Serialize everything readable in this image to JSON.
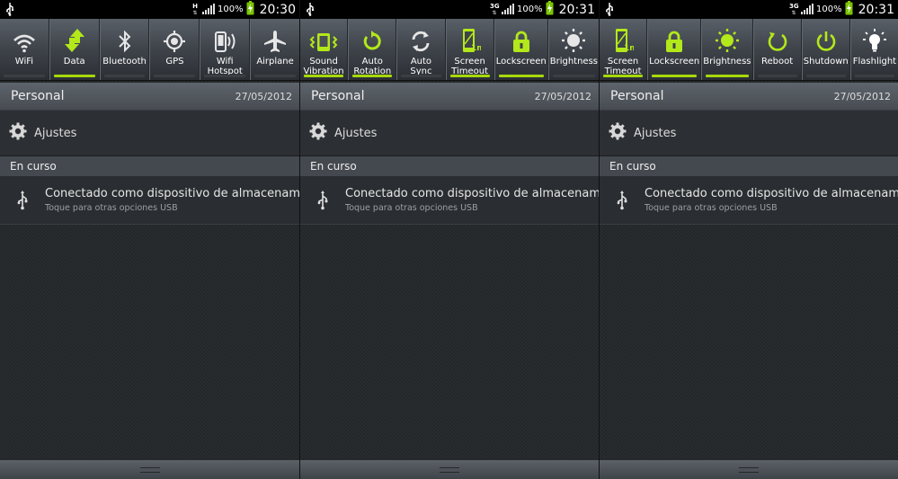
{
  "accent_color": "#a6d80b",
  "panels": [
    {
      "status": {
        "network": "H",
        "battery": "100%",
        "time": "20:30"
      },
      "tiles": [
        {
          "label": "WiFi",
          "icon": "wifi-icon",
          "on": false
        },
        {
          "label": "Data",
          "icon": "data-arrows-icon",
          "on": true
        },
        {
          "label": "Bluetooth",
          "icon": "bluetooth-icon",
          "on": false
        },
        {
          "label": "GPS",
          "icon": "gps-icon",
          "on": false
        },
        {
          "label": "Wifi\nHotspot",
          "icon": "hotspot-icon",
          "on": false
        },
        {
          "label": "Airplane",
          "icon": "airplane-icon",
          "on": false
        }
      ]
    },
    {
      "status": {
        "network": "3G",
        "battery": "100%",
        "time": "20:31"
      },
      "tiles": [
        {
          "label": "Sound\nVibration",
          "icon": "vibration-icon",
          "on": true
        },
        {
          "label": "Auto\nRotation",
          "icon": "rotation-icon",
          "on": true
        },
        {
          "label": "Auto Sync",
          "icon": "sync-icon",
          "on": false
        },
        {
          "label": "Screen\nTimeout",
          "icon": "screen-timeout-icon",
          "on": true
        },
        {
          "label": "Lockscreen",
          "icon": "lock-icon",
          "on": true
        },
        {
          "label": "Brightness",
          "icon": "brightness-icon",
          "on": false
        }
      ]
    },
    {
      "status": {
        "network": "3G",
        "battery": "100%",
        "time": "20:31"
      },
      "tiles": [
        {
          "label": "Screen\nTimeout",
          "icon": "screen-timeout-icon",
          "on": true
        },
        {
          "label": "Lockscreen",
          "icon": "lock-icon",
          "on": true
        },
        {
          "label": "Brightness",
          "icon": "brightness-icon",
          "on": true
        },
        {
          "label": "Reboot",
          "icon": "reboot-icon",
          "on": false
        },
        {
          "label": "Shutdown",
          "icon": "shutdown-icon",
          "on": false
        },
        {
          "label": "Flashlight",
          "icon": "flashlight-icon",
          "on": false
        }
      ]
    }
  ],
  "header": {
    "title": "Personal",
    "date": "27/05/2012"
  },
  "settings_label": "Ajustes",
  "ongoing_section": "En curso",
  "notification": {
    "title": "Conectado como dispositivo de almacenami",
    "subtitle": "Toque para otras opciones USB"
  }
}
